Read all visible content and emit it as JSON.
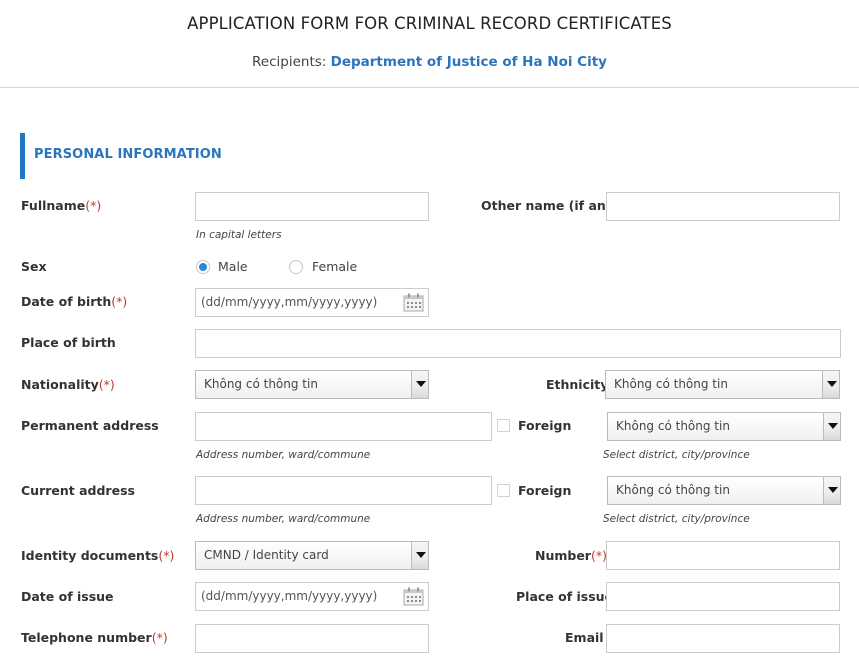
{
  "header": {
    "title": "APPLICATION FORM FOR CRIMINAL RECORD CERTIFICATES",
    "recipients_label": "Recipients:",
    "recipients_value": "Department of Justice of Ha Noi City"
  },
  "section": {
    "title": "PERSONAL INFORMATION",
    "accent_color": "#1f76c2"
  },
  "required_marker": "(*)",
  "fields": {
    "fullname": {
      "label": "Fullname",
      "required": true,
      "value": "",
      "hint": "In capital letters"
    },
    "other_name": {
      "label": "Other name (if any)",
      "value": ""
    },
    "sex": {
      "label": "Sex",
      "options": [
        "Male",
        "Female"
      ],
      "selected": "Male"
    },
    "date_of_birth": {
      "label": "Date of birth",
      "required": true,
      "placeholder": "(dd/mm/yyyy,mm/yyyy,yyyy)",
      "icon": "calendar-icon"
    },
    "place_of_birth": {
      "label": "Place of birth",
      "value": ""
    },
    "nationality": {
      "label": "Nationality",
      "required": true,
      "selected": "Không có thông tin"
    },
    "ethnicity": {
      "label": "Ethnicity",
      "selected": "Không có thông tin"
    },
    "permanent_address": {
      "label": "Permanent address",
      "value": "",
      "hint": "Address number, ward/commune",
      "foreign_label": "Foreign",
      "foreign_checked": false,
      "district_selected": "Không có thông tin",
      "district_hint": "Select district, city/province"
    },
    "current_address": {
      "label": "Current address",
      "value": "",
      "hint": "Address number, ward/commune",
      "foreign_label": "Foreign",
      "foreign_checked": false,
      "district_selected": "Không có thông tin",
      "district_hint": "Select district, city/province"
    },
    "identity_documents": {
      "label": "Identity documents",
      "required": true,
      "selected": "CMND / Identity card"
    },
    "number": {
      "label": "Number",
      "required": true,
      "value": ""
    },
    "date_of_issue": {
      "label": "Date of issue",
      "placeholder": "(dd/mm/yyyy,mm/yyyy,yyyy)",
      "icon": "calendar-icon"
    },
    "place_of_issue": {
      "label": "Place of issue",
      "value": ""
    },
    "telephone": {
      "label": "Telephone number",
      "required": true,
      "value": ""
    },
    "email": {
      "label": "Email",
      "value": ""
    }
  }
}
